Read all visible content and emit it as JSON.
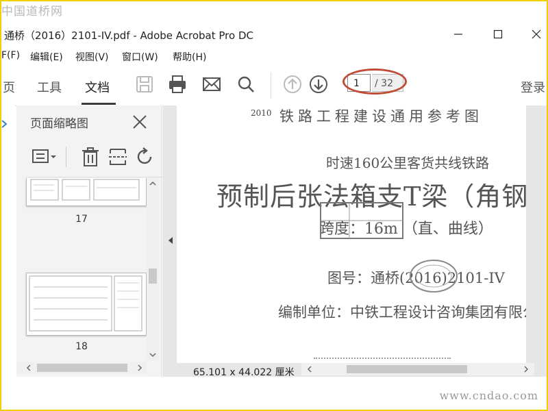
{
  "watermarks": {
    "top": "中国道桥网",
    "bottom": "www.cndao.com"
  },
  "window": {
    "title": "通桥（2016）2101-IV.pdf - Adobe Acrobat Pro DC"
  },
  "menu": [
    "F(F)",
    "编辑(E)",
    "视图(V)",
    "窗口(W)",
    "帮助(H)"
  ],
  "toolbar": {
    "tabs": [
      {
        "label": "页"
      },
      {
        "label": "工具"
      },
      {
        "label": "文档"
      }
    ],
    "page_current": "1",
    "page_total": "/ 32",
    "login": "登录"
  },
  "panel": {
    "title": "页面缩略图",
    "thumbnails": [
      {
        "label": "17"
      },
      {
        "label": "18"
      }
    ]
  },
  "document": {
    "header": "铁路工程建设通用参考图",
    "header_code": "2010",
    "subtitle": "时速160公里客货共线铁路",
    "main_title": "预制后张法箱支T梁（角钢支架",
    "span": "跨度：16m  （直、曲线）",
    "drawing_number": "图号：通桥(2016)2101-IV",
    "compiler": "编制单位：中铁工程设计咨询集团有限公司"
  },
  "status": {
    "dimensions": "65.101 x 44.022 厘米"
  },
  "colors": {
    "highlight_oval": "#c04b37",
    "frame": "#f0d000",
    "accent_blue": "#3b7fc4"
  }
}
